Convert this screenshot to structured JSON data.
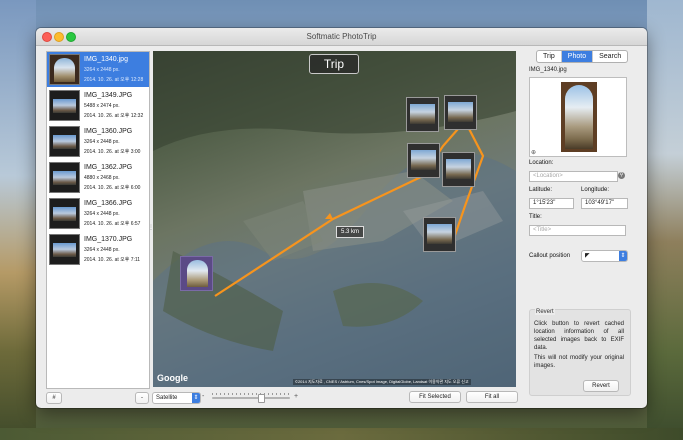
{
  "window": {
    "title": "Softmatic PhotoTrip"
  },
  "photos": [
    {
      "name": "IMG_1340.jpg",
      "size": "3264 x 2448 px.",
      "date": "2014. 10. 26. at 오후 12:28"
    },
    {
      "name": "IMG_1349.JPG",
      "size": "5488 x 2474 px.",
      "date": "2014. 10. 26. at 오후 12:32"
    },
    {
      "name": "IMG_1360.JPG",
      "size": "3264 x 2448 px.",
      "date": "2014. 10. 26. at 오후 3:00"
    },
    {
      "name": "IMG_1362.JPG",
      "size": "4880 x 2468 px.",
      "date": "2014. 10. 26. at 오후 6:00"
    },
    {
      "name": "IMG_1366.JPG",
      "size": "3264 x 2448 px.",
      "date": "2014. 10. 26. at 오후 6:57"
    },
    {
      "name": "IMG_1370.JPG",
      "size": "3264 x 2448 px.",
      "date": "2014. 10. 26. at 오후 7:11"
    }
  ],
  "map": {
    "title": "Trip",
    "distance": "5.3 km",
    "google": "Google",
    "copyright": "©2014 지도자료 , CNES / Astrium, Cnes/Spot Image, DigitalGlobe, Landsat   이용약관   지도 오류 신고",
    "route_color": "#f7941d"
  },
  "bottom_bar": {
    "hash_button": "#",
    "minus_button": "-",
    "map_type": "Satellite",
    "zoom_minus": "-",
    "zoom_plus": "+",
    "fit_selected": "Fit Selected",
    "fit_all": "Fit all"
  },
  "panel": {
    "tabs": [
      {
        "label": "Trip",
        "active": false
      },
      {
        "label": "Photo",
        "active": true
      },
      {
        "label": "Search",
        "active": false
      }
    ],
    "filename": "IMG_1340.jpg",
    "location_label": "Location:",
    "location_placeholder": "<Location>",
    "latitude_label": "Latitude:",
    "latitude_value": "1°15'23\"",
    "longitude_label": "Longitude:",
    "longitude_value": "103°49'17\"",
    "title_label": "Title:",
    "title_placeholder": "<Title>",
    "callout_label": "Callout position",
    "revert_title": "Revert",
    "revert_text": "Click button to revert cached location information of all selected images back to EXIF data.",
    "revert_note": "This will not modify your original images.",
    "revert_button": "Revert"
  },
  "colors": {
    "accent": "#3d7ee0",
    "route": "#f7941d"
  }
}
